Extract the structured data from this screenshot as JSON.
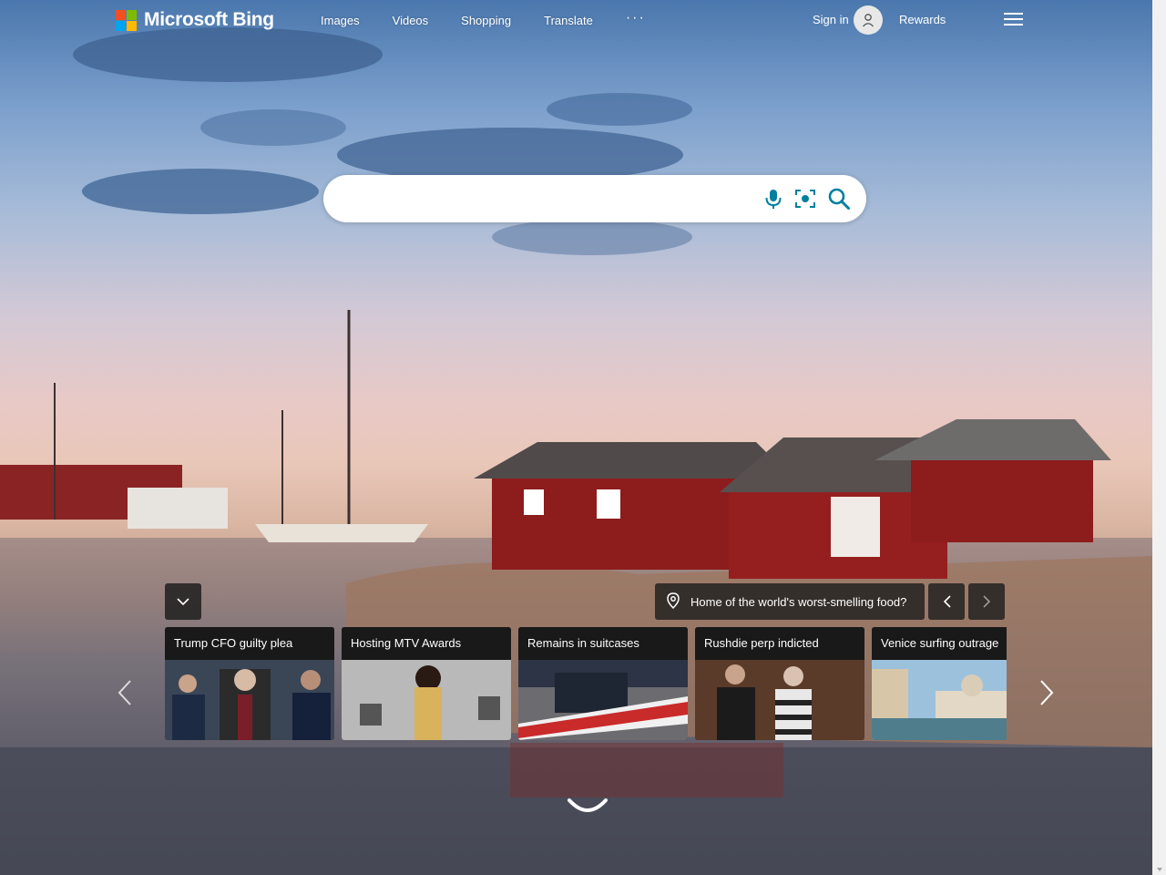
{
  "header": {
    "brand": "Microsoft Bing",
    "nav": [
      "Images",
      "Videos",
      "Shopping",
      "Translate"
    ],
    "more_label": "···",
    "sign_in": "Sign in",
    "rewards": "Rewards"
  },
  "search": {
    "value": "",
    "placeholder": ""
  },
  "image_info": {
    "caption": "Home of the world's worst-smelling food?"
  },
  "news": [
    {
      "title": "Trump CFO guilty plea"
    },
    {
      "title": "Hosting MTV Awards"
    },
    {
      "title": "Remains in suitcases"
    },
    {
      "title": "Rushdie perp indicted"
    },
    {
      "title": "Venice surfing outrage"
    }
  ],
  "icons": {
    "microphone": "microphone-icon",
    "visual_search": "visual-search-icon",
    "search": "search-icon",
    "location": "location-pin-icon"
  },
  "colors": {
    "accent": "#00809d",
    "house_red": "#8d1c1c"
  }
}
